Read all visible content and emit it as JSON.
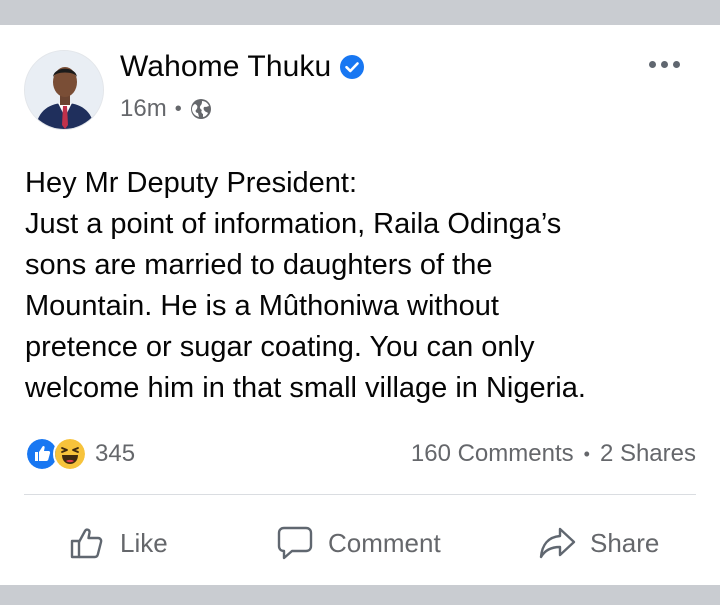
{
  "post": {
    "author_name": "Wahome Thuku",
    "time_ago": "16m",
    "separator": "•",
    "audience_icon": "globe-icon",
    "verified_icon": "verified-badge-icon",
    "more_icon": "more-options-icon",
    "body_lines": [
      "Hey Mr Deputy President:",
      "Just a point of information, Raila Odinga’s",
      "sons are married to daughters of the",
      "Mountain. He is a Mûthoniwa without",
      "pretence or sugar coating. You can only",
      "welcome him in that small village in Nigeria."
    ]
  },
  "engagement": {
    "reaction_icons": [
      "like-reaction-icon",
      "haha-reaction-icon"
    ],
    "reaction_count": "345",
    "comments": "160 Comments",
    "separator": "•",
    "shares": "2 Shares"
  },
  "actions": {
    "like_label": "Like",
    "comment_label": "Comment",
    "share_label": "Share"
  },
  "colors": {
    "brand_blue": "#1877f2",
    "secondary_text": "#65676b",
    "background": "#c9ccd1",
    "card": "#ffffff"
  }
}
